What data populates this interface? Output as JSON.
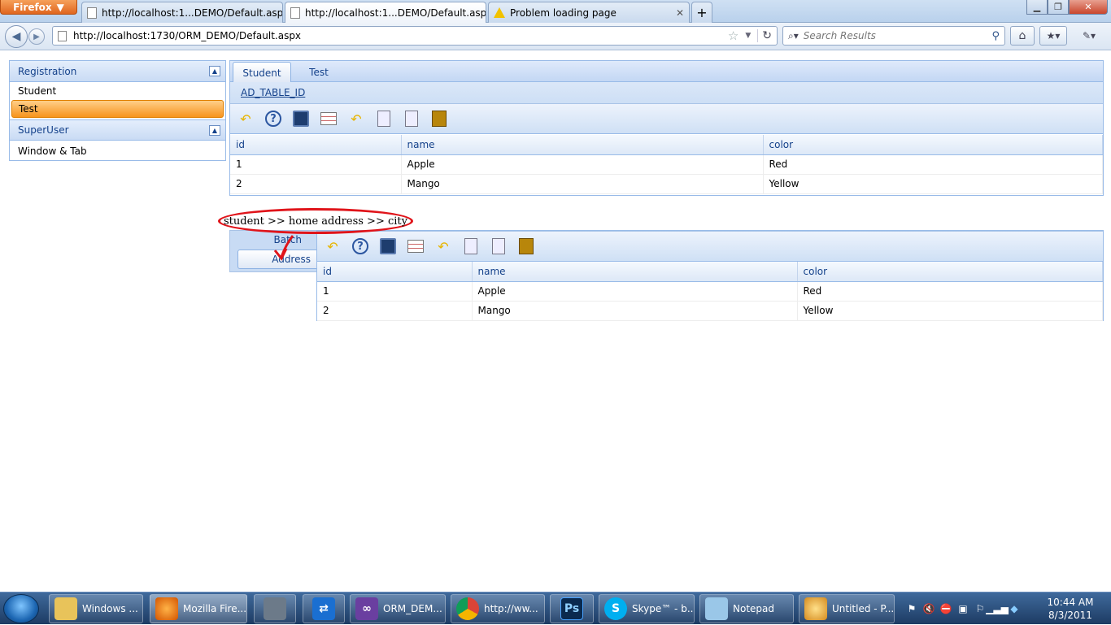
{
  "browser": {
    "menu_label": "Firefox",
    "tabs": [
      {
        "title": "http://localhost:1...DEMO/Default.aspx",
        "active": false
      },
      {
        "title": "http://localhost:1...DEMO/Default.aspx",
        "active": true
      },
      {
        "title": "Problem loading page",
        "active": false
      }
    ],
    "new_tab": "+",
    "url": "http://localhost:1730/ORM_DEMO/Default.aspx",
    "search_placeholder": "Search Results"
  },
  "left_panel": {
    "sections": [
      {
        "title": "Registration",
        "items": [
          "Student",
          "Test"
        ],
        "selected": "Test"
      },
      {
        "title": "SuperUser",
        "items": [
          "Window & Tab"
        ]
      }
    ],
    "toggle_glyph": "▲"
  },
  "main_panel": {
    "tabs": [
      "Student",
      "Test"
    ],
    "active_tab": "Student",
    "ad_link": "AD_TABLE_ID",
    "toolbar_icons": [
      "undo-icon",
      "help-icon",
      "save-icon",
      "grid-icon",
      "undo-icon",
      "form-icon",
      "form-icon",
      "archive-icon"
    ],
    "grid": {
      "columns": [
        "id",
        "name",
        "color"
      ],
      "rows": [
        [
          "1",
          "Apple",
          "Red"
        ],
        [
          "2",
          "Mango",
          "Yellow"
        ]
      ]
    }
  },
  "annotation": {
    "text": "student >> home address >> city",
    "color": "#e0141a"
  },
  "sub_area": {
    "side_tabs": [
      "Batch",
      "Address"
    ],
    "grid": {
      "columns": [
        "id",
        "name",
        "color"
      ],
      "rows": [
        [
          "1",
          "Apple",
          "Red"
        ],
        [
          "2",
          "Mango",
          "Yellow"
        ]
      ]
    }
  },
  "taskbar": {
    "buttons": [
      "Windows ...",
      "Mozilla Fire...",
      "",
      "",
      "ORM_DEM...",
      "http://ww...",
      "",
      "Skype™ - b...",
      "Notepad",
      "Untitled - P..."
    ],
    "ps_label": "Ps",
    "clock_time": "10:44 AM",
    "clock_date": "8/3/2011"
  }
}
